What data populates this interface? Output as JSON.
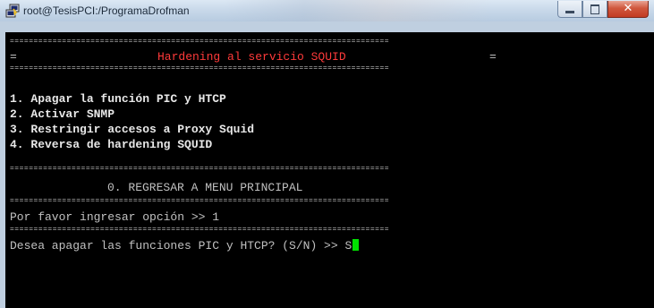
{
  "window": {
    "title": "root@TesisPCI:/ProgramaDrofman",
    "icon": "putty-icon",
    "controls": {
      "minimize": "minimize-icon",
      "maximize": "maximize-icon",
      "close": "✕"
    }
  },
  "terminal": {
    "separator": "================================================================================",
    "header_left": "=",
    "header_title": "Hardening al servicio SQUID",
    "header_right": "=",
    "menu_items": [
      "1. Apagar la función PIC y HTCP",
      "2. Activar SNMP",
      "3. Restringir accesos a Proxy Squid",
      "4. Reversa de hardening SQUID"
    ],
    "return_option": "0. REGRESAR A MENU PRINCIPAL",
    "prompt_text": "Por favor ingresar opción >> 1",
    "question_text": "Desea apagar las funciones PIC y HTCP? (S/N) >> ",
    "input_value": "S"
  },
  "colors": {
    "title_red": "#ff3a3a",
    "cursor_green": "#00e000",
    "terminal_bg": "#000000"
  }
}
